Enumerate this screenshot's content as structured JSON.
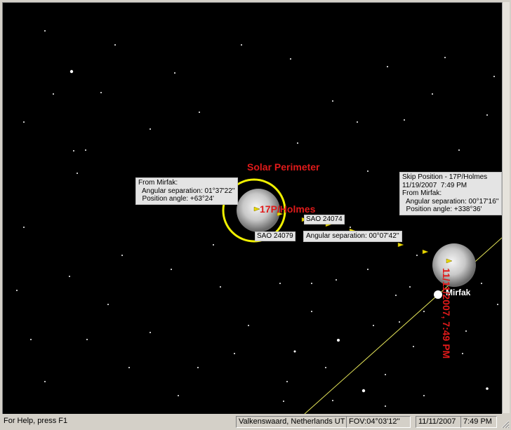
{
  "sky_labels": {
    "solar_perimeter": "Solar Perimeter",
    "comet_name": "17P/Holmes",
    "mirfak": "Mirfak",
    "sao_24074": "SAO 24074",
    "sao_24079": "SAO 24079",
    "comet_date": "11/11/2007, 7:49 PM"
  },
  "info_boxes": {
    "from_mirfak": "From Mirfak:\n  Angular separation: 01°37'22''\n  Position angle: +63°24'",
    "angular_sep": "Angular separation: 00°07'42''",
    "skip_position": "Skip Position - 17P/Holmes\n11/19/2007  7:49 PM\nFrom Mirfak:\n  Angular separation: 00°17'16''\n  Position angle: +338°36'"
  },
  "status": {
    "help": "For Help, press F1",
    "location": "Valkenswaard, Netherlands UT",
    "fov": "FOV:04°03'12''",
    "date": "11/11/2007",
    "time": "7:49 PM"
  },
  "colors": {
    "sky": "#000000",
    "label_red": "#e01a1a",
    "perimeter_yellow": "#f0f000",
    "comet_yellow": "#e8d800"
  }
}
